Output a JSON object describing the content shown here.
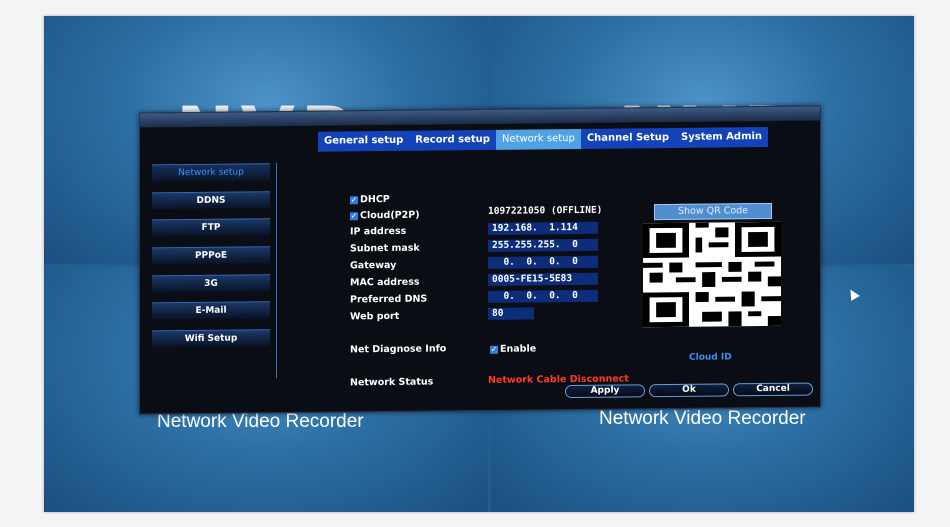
{
  "background": {
    "logo_text": "NVR",
    "captions": [
      "Network Video Recorder",
      "Network Video Recorder"
    ]
  },
  "tabs": [
    {
      "label": "General setup",
      "active": false
    },
    {
      "label": "Record setup",
      "active": false
    },
    {
      "label": "Network setup",
      "active": true
    },
    {
      "label": "Channel Setup",
      "active": false
    },
    {
      "label": "System Admin",
      "active": false
    }
  ],
  "sidebar": {
    "items": [
      {
        "label": "Network setup",
        "active": true
      },
      {
        "label": "DDNS",
        "active": false
      },
      {
        "label": "FTP",
        "active": false
      },
      {
        "label": "PPPoE",
        "active": false
      },
      {
        "label": "3G",
        "active": false
      },
      {
        "label": "E-Mail",
        "active": false
      },
      {
        "label": "Wifi Setup",
        "active": false
      }
    ]
  },
  "form": {
    "dhcp": {
      "label": "DHCP",
      "checked": true
    },
    "cloud": {
      "label": "Cloud(P2P)",
      "checked": true,
      "value": "1097221050 (OFFLINE)"
    },
    "ip": {
      "label": "IP address",
      "value": "192.168.  1.114"
    },
    "subnet": {
      "label": "Subnet mask",
      "value": "255.255.255.  0"
    },
    "gateway": {
      "label": "Gateway",
      "value": "  0.  0.  0.  0"
    },
    "mac": {
      "label": "MAC address",
      "value": "0005-FE15-5E83"
    },
    "dns": {
      "label": "Preferred DNS",
      "value": "  0.  0.  0.  0"
    },
    "port": {
      "label": "Web port",
      "value": "80"
    },
    "diagnose": {
      "label": "Net Diagnose Info",
      "checkbox_label": "Enable",
      "checked": true
    },
    "status": {
      "label": "Network Status",
      "value": "Network Cable Disconnect"
    }
  },
  "qr": {
    "button_label": "Show QR Code",
    "caption": "Cloud ID"
  },
  "buttons": {
    "apply": "Apply",
    "ok": "Ok",
    "cancel": "Cancel"
  },
  "colors": {
    "tab_active": "#4fa2e4",
    "tab": "#1442b8",
    "status_error": "#ff3a2a",
    "accent": "#3e8ff2"
  }
}
